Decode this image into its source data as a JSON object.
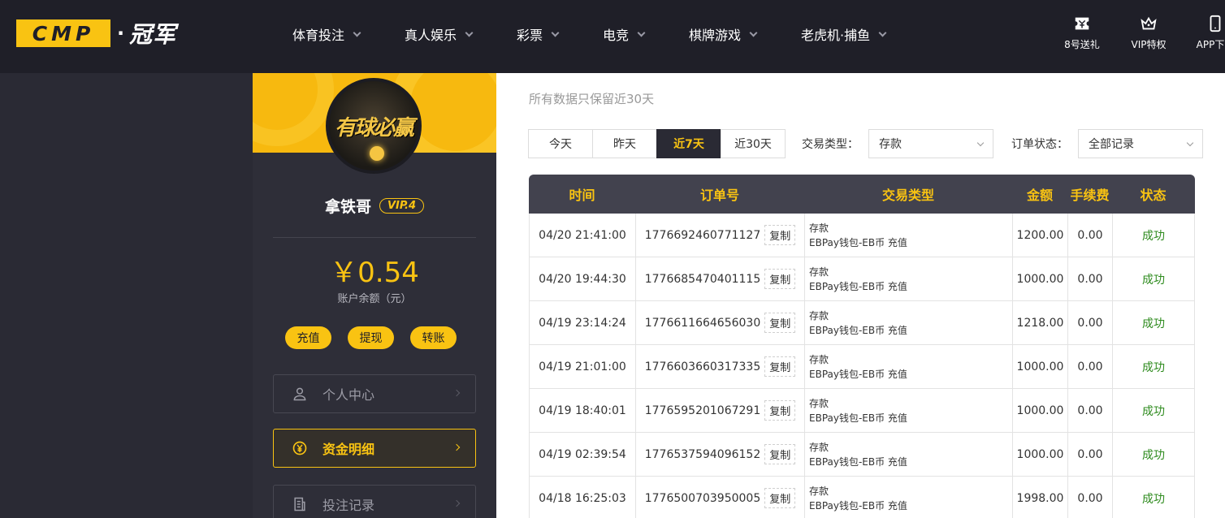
{
  "brand": {
    "logo_letters": "CMP",
    "logo_dot": "·",
    "logo_text": "冠军"
  },
  "nav": [
    {
      "label": "体育投注"
    },
    {
      "label": "真人娱乐"
    },
    {
      "label": "彩票"
    },
    {
      "label": "电竞"
    },
    {
      "label": "棋牌游戏"
    },
    {
      "label": "老虎机·捕鱼"
    }
  ],
  "tools": [
    {
      "label": "8号送礼",
      "icon": "ticket-icon"
    },
    {
      "label": "VIP特权",
      "icon": "crown-icon"
    },
    {
      "label": "APP下载",
      "icon": "phone-icon"
    }
  ],
  "sidebar": {
    "avatar_text": "有球必赢",
    "username": "拿铁哥",
    "vip": "VIP.4",
    "balance": "￥0.54",
    "balance_label": "账户余额（元）",
    "actions": [
      "充值",
      "提现",
      "转账"
    ],
    "menu": [
      {
        "label": "个人中心",
        "icon": "user-icon",
        "active": false
      },
      {
        "label": "资金明细",
        "icon": "yen-coin-icon",
        "active": true
      },
      {
        "label": "投注记录",
        "icon": "receipt-icon",
        "active": false
      }
    ]
  },
  "main": {
    "subtitle": "所有数据只保留近30天",
    "ranges": [
      "今天",
      "昨天",
      "近7天",
      "近30天"
    ],
    "active_range": "近7天",
    "type_label": "交易类型：",
    "type_value": "存款",
    "status_label": "订单状态：",
    "status_value": "全部记录",
    "columns": [
      "时间",
      "订单号",
      "交易类型",
      "金额",
      "手续费",
      "状态"
    ],
    "copy_label": "复制",
    "rows": [
      {
        "time": "04/20 21:41:00",
        "order": "1776692460771127",
        "type": "存款",
        "detail": "EBPay钱包-EB币 充值",
        "amount": "1200.00",
        "fee": "0.00",
        "status": "成功"
      },
      {
        "time": "04/20 19:44:30",
        "order": "1776685470401115",
        "type": "存款",
        "detail": "EBPay钱包-EB币 充值",
        "amount": "1000.00",
        "fee": "0.00",
        "status": "成功"
      },
      {
        "time": "04/19 23:14:24",
        "order": "1776611664656030",
        "type": "存款",
        "detail": "EBPay钱包-EB币 充值",
        "amount": "1218.00",
        "fee": "0.00",
        "status": "成功"
      },
      {
        "time": "04/19 21:01:00",
        "order": "1776603660317335",
        "type": "存款",
        "detail": "EBPay钱包-EB币 充值",
        "amount": "1000.00",
        "fee": "0.00",
        "status": "成功"
      },
      {
        "time": "04/19 18:40:01",
        "order": "1776595201067291",
        "type": "存款",
        "detail": "EBPay钱包-EB币 充值",
        "amount": "1000.00",
        "fee": "0.00",
        "status": "成功"
      },
      {
        "time": "04/19 02:39:54",
        "order": "1776537594096152",
        "type": "存款",
        "detail": "EBPay钱包-EB币 充值",
        "amount": "1000.00",
        "fee": "0.00",
        "status": "成功"
      },
      {
        "time": "04/18 16:25:03",
        "order": "1776500703950005",
        "type": "存款",
        "detail": "EBPay钱包-EB币 充值",
        "amount": "1998.00",
        "fee": "0.00",
        "status": "成功"
      }
    ]
  },
  "colors": {
    "accent": "#f9c312",
    "header_bg": "#1f1f28",
    "sidebar_bg": "#2e2e38",
    "success": "#2e8b1e"
  }
}
